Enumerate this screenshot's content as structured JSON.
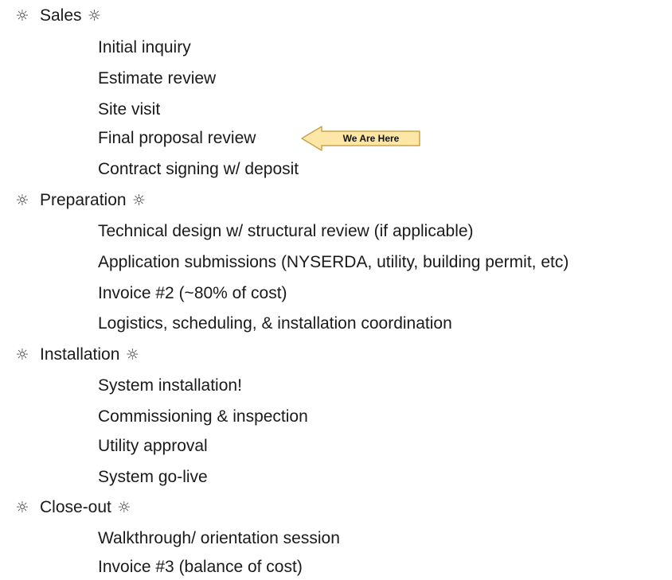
{
  "phases": [
    {
      "label": "Sales",
      "items": [
        "Initial inquiry",
        "Estimate review",
        "Site visit",
        "Final proposal review",
        "Contract signing w/ deposit"
      ]
    },
    {
      "label": "Preparation",
      "items": [
        "Technical design w/ structural review (if applicable)",
        "Application submissions (NYSERDA, utility, building permit, etc)",
        "Invoice #2 (~80% of cost)",
        "Logistics, scheduling, & installation coordination"
      ]
    },
    {
      "label": "Installation",
      "items": [
        "System installation!",
        "Commissioning & inspection",
        "Utility approval",
        "System go-live"
      ]
    },
    {
      "label": "Close-out",
      "items": [
        "Walkthrough/ orientation session",
        "Invoice #3 (balance of cost)"
      ]
    }
  ],
  "phase_icon": "sun-icon",
  "phase_icon_glyph": "☼",
  "marker": {
    "label": "We Are Here",
    "fill": "#fde6a6",
    "stroke": "#c9a44a",
    "icon": "left-arrow-icon"
  }
}
